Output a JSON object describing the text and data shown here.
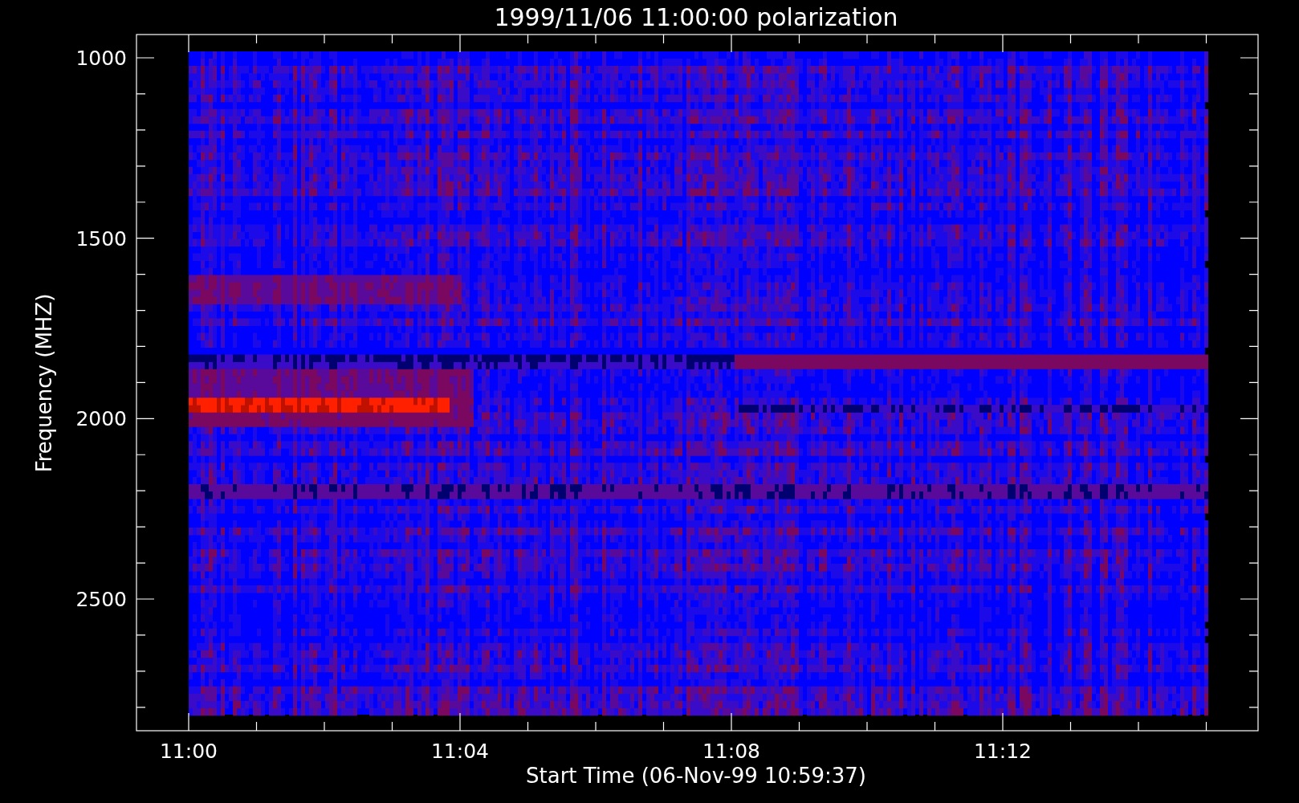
{
  "plot": {
    "title": "1999/11/06 11:00:00 polarization",
    "ylabel": "Frequency (MHZ)",
    "xlabel": "Start Time (06-Nov-99 10:59:37)",
    "yticks": [
      "1000",
      "1500",
      "2000",
      "2500"
    ],
    "xticks": [
      "11:00",
      "11:04",
      "11:08",
      "11:12"
    ]
  }
}
